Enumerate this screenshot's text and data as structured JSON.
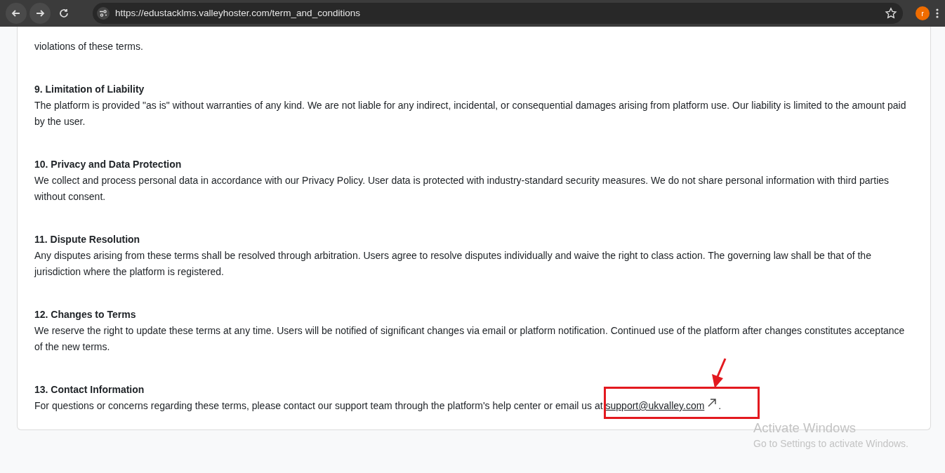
{
  "browser": {
    "url": "https://edustacklms.valleyhoster.com/term_and_conditions",
    "profile_initial": "r"
  },
  "intro_tail": "violations of these terms.",
  "sections": [
    {
      "heading": "9. Limitation of Liability",
      "body": "The platform is provided \"as is\" without warranties of any kind. We are not liable for any indirect, incidental, or consequential damages arising from platform use. Our liability is limited to the amount paid by the user."
    },
    {
      "heading": "10. Privacy and Data Protection",
      "body": "We collect and process personal data in accordance with our Privacy Policy. User data is protected with industry-standard security measures. We do not share personal information with third parties without consent."
    },
    {
      "heading": "11. Dispute Resolution",
      "body": "Any disputes arising from these terms shall be resolved through arbitration. Users agree to resolve disputes individually and waive the right to class action. The governing law shall be that of the jurisdiction where the platform is registered."
    },
    {
      "heading": "12. Changes to Terms",
      "body": "We reserve the right to update these terms at any time. Users will be notified of significant changes via email or platform notification. Continued use of the platform after changes constitutes acceptance of the new terms."
    },
    {
      "heading": "13. Contact Information",
      "body": "For questions or concerns regarding these terms, please contact our support team through the platform's help center or email us at",
      "link": "support@ukvalley.com",
      "body_after": "."
    }
  ],
  "windows_notice": {
    "title": "Activate Windows",
    "subtitle": "Go to Settings to activate Windows."
  }
}
